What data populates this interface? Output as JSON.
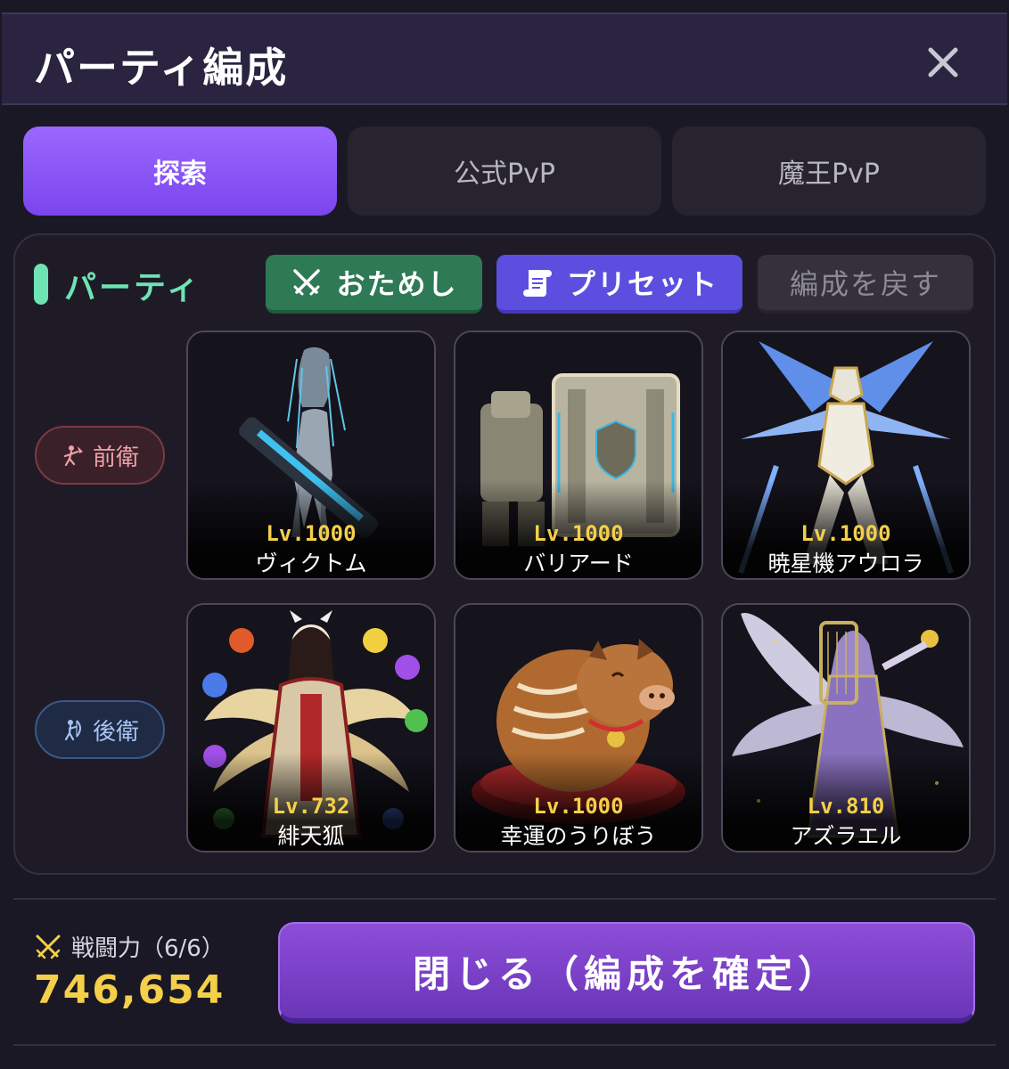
{
  "header": {
    "title": "パーティ編成",
    "close_icon": "close-icon"
  },
  "tabs": [
    {
      "label": "探索",
      "active": true
    },
    {
      "label": "公式PvP",
      "active": false
    },
    {
      "label": "魔王PvP",
      "active": false
    }
  ],
  "party": {
    "label": "パーティ",
    "trial_label": "おためし",
    "preset_label": "プリセット",
    "revert_label": "編成を戻す",
    "front_label": "前衛",
    "back_label": "後衛"
  },
  "characters": {
    "front": [
      {
        "level": "Lv.1000",
        "name": "ヴィクトム",
        "icon": "cyborg-swordswoman"
      },
      {
        "level": "Lv.1000",
        "name": "バリアード",
        "icon": "shield-mech"
      },
      {
        "level": "Lv.1000",
        "name": "暁星機アウロラ",
        "icon": "winged-mech"
      }
    ],
    "back": [
      {
        "level": "Lv.732",
        "name": "緋天狐",
        "icon": "fox-priestess"
      },
      {
        "level": "Lv.1000",
        "name": "幸運のうりぼう",
        "icon": "lucky-boar"
      },
      {
        "level": "Lv.810",
        "name": "アズラエル",
        "icon": "angel-bard"
      }
    ]
  },
  "footer": {
    "power_label": "戦闘力（6/6）",
    "power_value": "746,654",
    "confirm_label": "閉じる（編成を確定）"
  },
  "colors": {
    "accent": "#8b5cf6",
    "party_green": "#6ee3b4",
    "level_gold": "#f4cf4a",
    "front_role": "#f0a0a8",
    "back_role": "#a8c4f4"
  }
}
